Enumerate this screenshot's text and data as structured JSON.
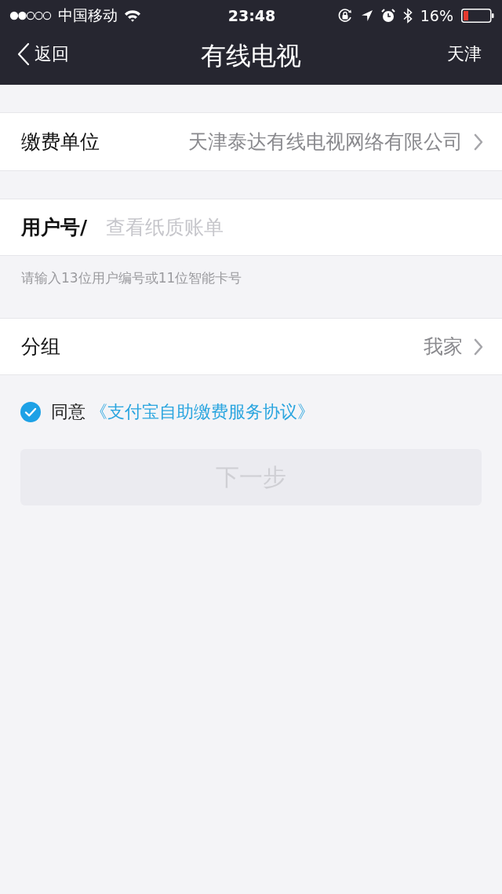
{
  "status_bar": {
    "carrier": "中国移动",
    "time": "23:48",
    "battery": "16%"
  },
  "nav": {
    "back": "返回",
    "title": "有线电视",
    "city": "天津"
  },
  "payee": {
    "label": "缴费单位",
    "value": "天津泰达有线电视网络有限公司"
  },
  "account": {
    "label": "用户号/",
    "placeholder": "查看纸质账单",
    "hint": "请输入13位用户编号或11位智能卡号"
  },
  "group": {
    "label": "分组",
    "value": "我家"
  },
  "agreement": {
    "checked": true,
    "prefix": "同意",
    "link": "《支付宝自助缴费服务协议》"
  },
  "next_button": {
    "label": "下一步",
    "disabled": true
  }
}
